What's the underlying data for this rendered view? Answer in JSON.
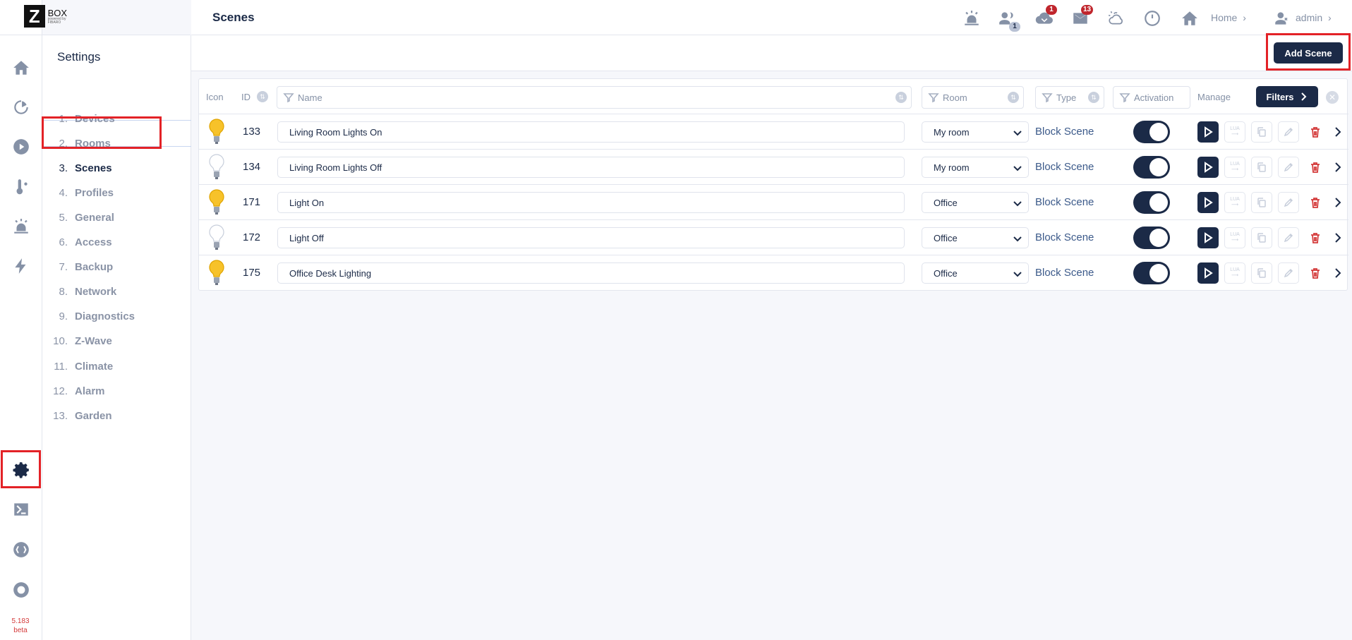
{
  "app": {
    "logo_letter": "Z",
    "logo_text": "BOX",
    "logo_subtext": "powered by FIBARO",
    "version": "5.183",
    "version_tag": "beta"
  },
  "header": {
    "title": "Scenes",
    "home_label": "Home",
    "user_label": "admin",
    "badges": {
      "users": "1",
      "updates": "1",
      "messages": "13"
    }
  },
  "menu": {
    "title": "Settings",
    "items": [
      {
        "num": "1.",
        "label": "Devices"
      },
      {
        "num": "2.",
        "label": "Rooms"
      },
      {
        "num": "3.",
        "label": "Scenes"
      },
      {
        "num": "4.",
        "label": "Profiles"
      },
      {
        "num": "5.",
        "label": "General"
      },
      {
        "num": "6.",
        "label": "Access"
      },
      {
        "num": "7.",
        "label": "Backup"
      },
      {
        "num": "8.",
        "label": "Network"
      },
      {
        "num": "9.",
        "label": "Diagnostics"
      },
      {
        "num": "10.",
        "label": "Z-Wave"
      },
      {
        "num": "11.",
        "label": "Climate"
      },
      {
        "num": "12.",
        "label": "Alarm"
      },
      {
        "num": "13.",
        "label": "Garden"
      }
    ],
    "active_index": 2
  },
  "toolbar": {
    "add_scene_label": "Add Scene"
  },
  "table": {
    "headers": {
      "icon": "Icon",
      "id": "ID",
      "name": "Name",
      "room": "Room",
      "type": "Type",
      "activation": "Activation",
      "manage": "Manage",
      "filters_button": "Filters"
    },
    "lua_label": "LUA",
    "rows": [
      {
        "id": "133",
        "name": "Living Room Lights On",
        "room": "My room",
        "type": "Block Scene",
        "bulb_on": true,
        "active": true
      },
      {
        "id": "134",
        "name": "Living Room Lights Off",
        "room": "My room",
        "type": "Block Scene",
        "bulb_on": false,
        "active": true
      },
      {
        "id": "171",
        "name": "Light On",
        "room": "Office",
        "type": "Block Scene",
        "bulb_on": true,
        "active": true
      },
      {
        "id": "172",
        "name": "Light Off",
        "room": "Office",
        "type": "Block Scene",
        "bulb_on": false,
        "active": true
      },
      {
        "id": "175",
        "name": "Office Desk Lighting",
        "room": "Office",
        "type": "Block Scene",
        "bulb_on": true,
        "active": true
      }
    ]
  },
  "colors": {
    "navy": "#1b2a47",
    "highlight_red": "#e32227",
    "delete_red": "#d43a3a",
    "bulb_on": "#f7c22a",
    "bulb_off": "#ffffff"
  }
}
